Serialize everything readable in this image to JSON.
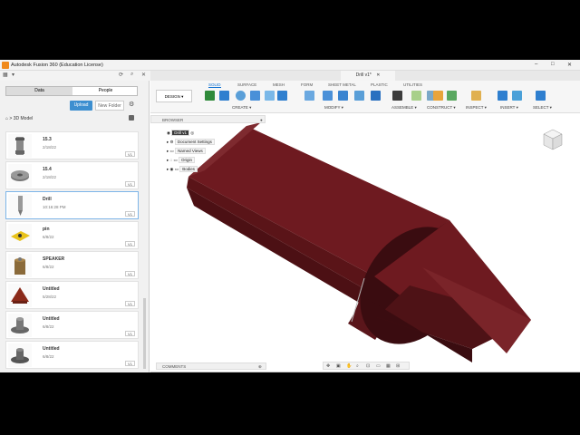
{
  "window": {
    "title": "Autodesk Fusion 360 (Education License)"
  },
  "data_panel": {
    "tabs": [
      "Data",
      "People"
    ],
    "upload_label": "Upload",
    "new_folder_label": "New Folder",
    "breadcrumb": "3D Model",
    "files": [
      {
        "name": "15.3",
        "date": "2/18/22",
        "version": "V1"
      },
      {
        "name": "15.4",
        "date": "2/18/22",
        "version": "V1"
      },
      {
        "name": "Drill",
        "date": "10:16:28 PM",
        "version": "V1",
        "selected": true
      },
      {
        "name": "pin",
        "date": "6/8/22",
        "version": "V1"
      },
      {
        "name": "SPEAKER",
        "date": "6/8/22",
        "version": "V1"
      },
      {
        "name": "Untitled",
        "date": "5/28/22",
        "version": "V1"
      },
      {
        "name": "Untitled",
        "date": "6/8/22",
        "version": "V1"
      },
      {
        "name": "Untitled",
        "date": "6/8/22",
        "version": "V1"
      }
    ]
  },
  "document_tab": {
    "title": "Drill v1*"
  },
  "toolbar": {
    "workspace": "DESIGN ▾",
    "tabs": [
      "SOLID",
      "SURFACE",
      "MESH",
      "FORM",
      "SHEET METAL",
      "PLASTIC",
      "UTILITIES"
    ],
    "groups": [
      "CREATE ▾",
      "MODIFY ▾",
      "ASSEMBLE ▾",
      "CONSTRUCT ▾",
      "INSPECT ▾",
      "INSERT ▾",
      "SELECT ▾"
    ]
  },
  "browser": {
    "title": "BROWSER",
    "root": "Drill v1",
    "items": [
      "Document Settings",
      "Named Views",
      "Origin",
      "Bodies"
    ]
  },
  "comments_label": "COMMENTS",
  "colors": {
    "accent": "#0a6ed1",
    "model": "#6e1a20",
    "upload": "#3d8fd0"
  }
}
